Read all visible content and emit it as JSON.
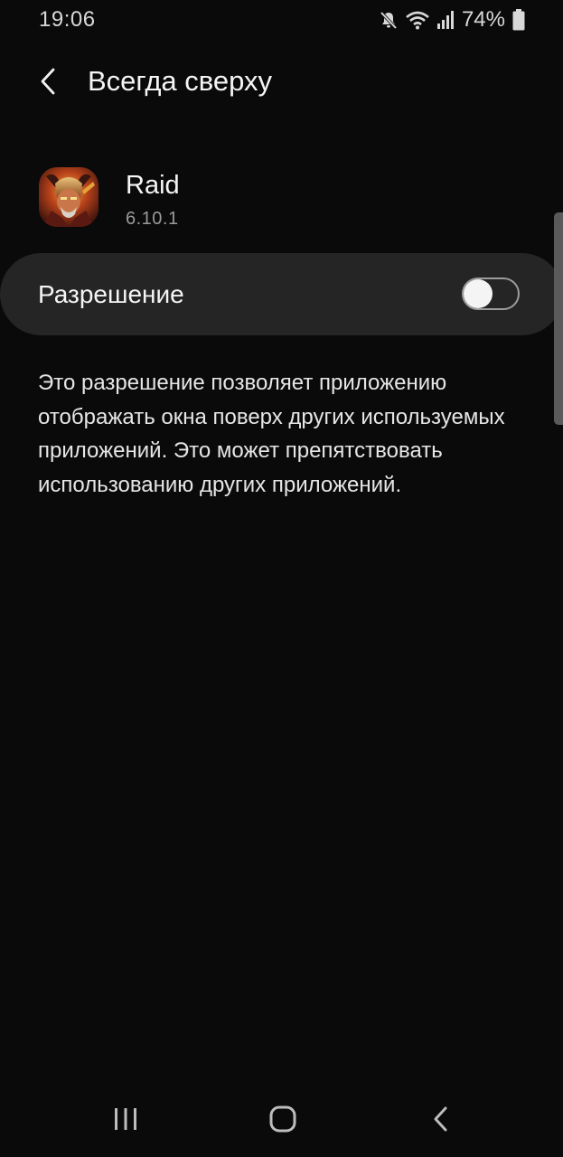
{
  "status_bar": {
    "time": "19:06",
    "battery": "74%",
    "icons": [
      "mute-icon",
      "wifi-icon",
      "signal-icon",
      "battery-icon"
    ]
  },
  "header": {
    "title": "Всегда сверху",
    "back_icon": "back-arrow-icon"
  },
  "app": {
    "name": "Raid",
    "version": "6.10.1",
    "icon": "raid-app-icon"
  },
  "permission": {
    "label": "Разрешение",
    "enabled": false
  },
  "description": "Это разрешение позволяет приложению отображать окна поверх других используемых приложений. Это может препятствовать использованию других приложений.",
  "nav_bar": {
    "buttons": [
      "recents-icon",
      "home-icon",
      "back-icon"
    ]
  },
  "colors": {
    "background": "#0a0a0a",
    "card": "#252525",
    "text": "#f5f5f5",
    "secondary_text": "#9a9a9a"
  }
}
